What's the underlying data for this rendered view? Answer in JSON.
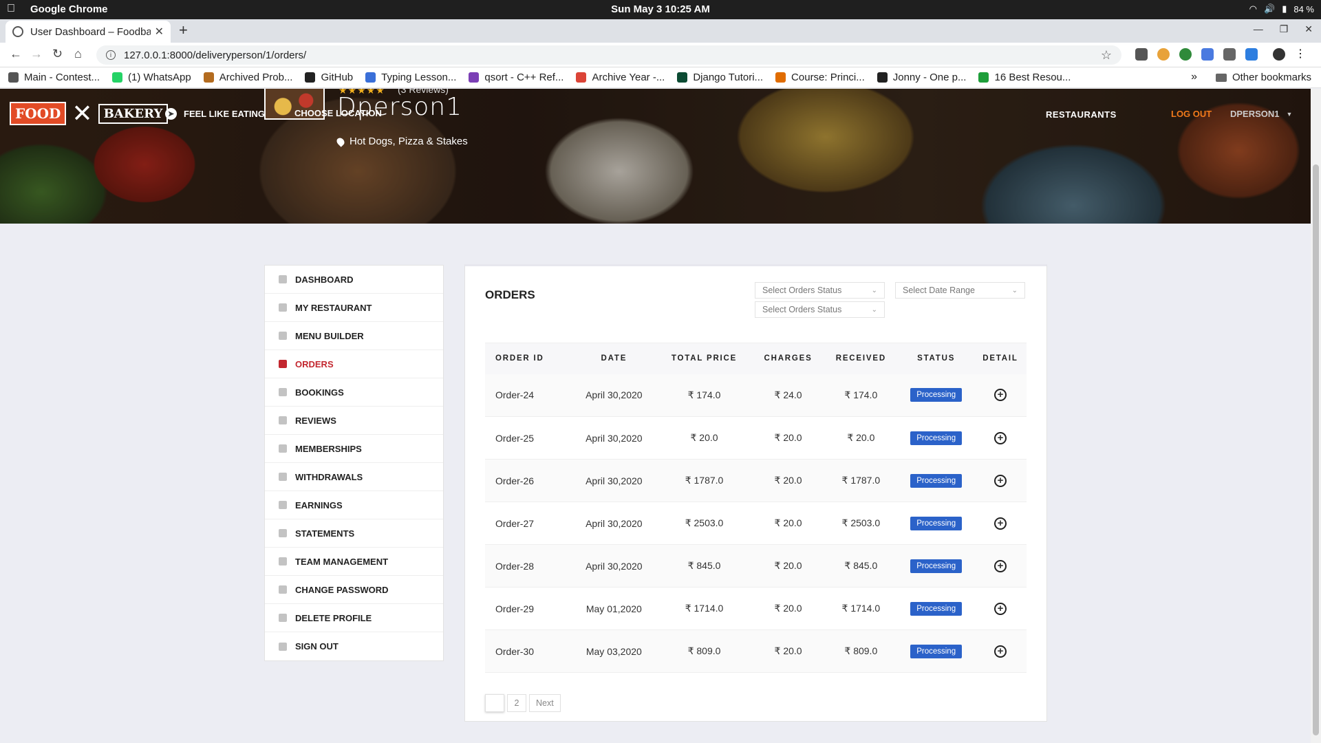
{
  "os": {
    "app_name": "Google Chrome",
    "clock": "Sun May 3  10:25 AM",
    "battery": "84 %"
  },
  "browser": {
    "tab_title": "User Dashboard – Foodba",
    "url": "127.0.0.1:8000/deliveryperson/1/orders/",
    "bookmarks": [
      {
        "label": "Main - Contest...",
        "color": "#555555"
      },
      {
        "label": "(1) WhatsApp",
        "color": "#25d366"
      },
      {
        "label": "Archived Prob...",
        "color": "#b36b1f"
      },
      {
        "label": "GitHub",
        "color": "#222222"
      },
      {
        "label": "Typing Lesson...",
        "color": "#3a6fd8"
      },
      {
        "label": "qsort - C++ Ref...",
        "color": "#7b3fb5"
      },
      {
        "label": "Archive Year -...",
        "color": "#db4437"
      },
      {
        "label": "Django Tutori...",
        "color": "#0c4b33"
      },
      {
        "label": "Course: Princi...",
        "color": "#e06c00"
      },
      {
        "label": "Jonny - One p...",
        "color": "#222222"
      },
      {
        "label": "16 Best Resou...",
        "color": "#1e9e3a"
      }
    ],
    "other_bookmarks": "Other bookmarks"
  },
  "header": {
    "logo_food": "FOOD",
    "logo_bakery": "BAKERY",
    "feel_like_eating": "FEEL LIKE EATING",
    "choose_location": "CHOOSE LOCATION",
    "stars": "★★★★★",
    "reviews": "(3 Reviews)",
    "profile_name": "Dperson1",
    "cuisine": "Hot Dogs, Pizza & Stakes",
    "nav_restaurants": "RESTAURANTS",
    "nav_logout": "LOG OUT",
    "nav_user": "DPERSON1"
  },
  "sidebar": {
    "items": [
      {
        "label": "DASHBOARD",
        "active": false
      },
      {
        "label": "MY RESTAURANT",
        "active": false
      },
      {
        "label": "MENU BUILDER",
        "active": false
      },
      {
        "label": "ORDERS",
        "active": true
      },
      {
        "label": "BOOKINGS",
        "active": false
      },
      {
        "label": "REVIEWS",
        "active": false
      },
      {
        "label": "MEMBERSHIPS",
        "active": false
      },
      {
        "label": "WITHDRAWALS",
        "active": false
      },
      {
        "label": "EARNINGS",
        "active": false
      },
      {
        "label": "STATEMENTS",
        "active": false
      },
      {
        "label": "TEAM MANAGEMENT",
        "active": false
      },
      {
        "label": "CHANGE PASSWORD",
        "active": false
      },
      {
        "label": "DELETE PROFILE",
        "active": false
      },
      {
        "label": "SIGN OUT",
        "active": false
      }
    ]
  },
  "orders": {
    "title": "ORDERS",
    "filter_status_1": "Select Orders Status",
    "filter_status_2": "Select Orders Status",
    "filter_date": "Select Date Range",
    "columns": [
      "ORDER ID",
      "DATE",
      "TOTAL PRICE",
      "CHARGES",
      "RECEIVED",
      "STATUS",
      "DETAIL"
    ],
    "rows": [
      {
        "id": "Order-24",
        "date": "April 30,2020",
        "total": "₹ 174.0",
        "charges": "₹ 24.0",
        "received": "₹ 174.0",
        "status": "Processing"
      },
      {
        "id": "Order-25",
        "date": "April 30,2020",
        "total": "₹ 20.0",
        "charges": "₹ 20.0",
        "received": "₹ 20.0",
        "status": "Processing"
      },
      {
        "id": "Order-26",
        "date": "April 30,2020",
        "total": "₹ 1787.0",
        "charges": "₹ 20.0",
        "received": "₹ 1787.0",
        "status": "Processing"
      },
      {
        "id": "Order-27",
        "date": "April 30,2020",
        "total": "₹ 2503.0",
        "charges": "₹ 20.0",
        "received": "₹ 2503.0",
        "status": "Processing"
      },
      {
        "id": "Order-28",
        "date": "April 30,2020",
        "total": "₹ 845.0",
        "charges": "₹ 20.0",
        "received": "₹ 845.0",
        "status": "Processing"
      },
      {
        "id": "Order-29",
        "date": "May 01,2020",
        "total": "₹ 1714.0",
        "charges": "₹ 20.0",
        "received": "₹ 1714.0",
        "status": "Processing"
      },
      {
        "id": "Order-30",
        "date": "May 03,2020",
        "total": "₹ 809.0",
        "charges": "₹ 20.0",
        "received": "₹ 809.0",
        "status": "Processing"
      }
    ],
    "pagination": {
      "current": "",
      "page2": "2",
      "next": "Next"
    }
  }
}
